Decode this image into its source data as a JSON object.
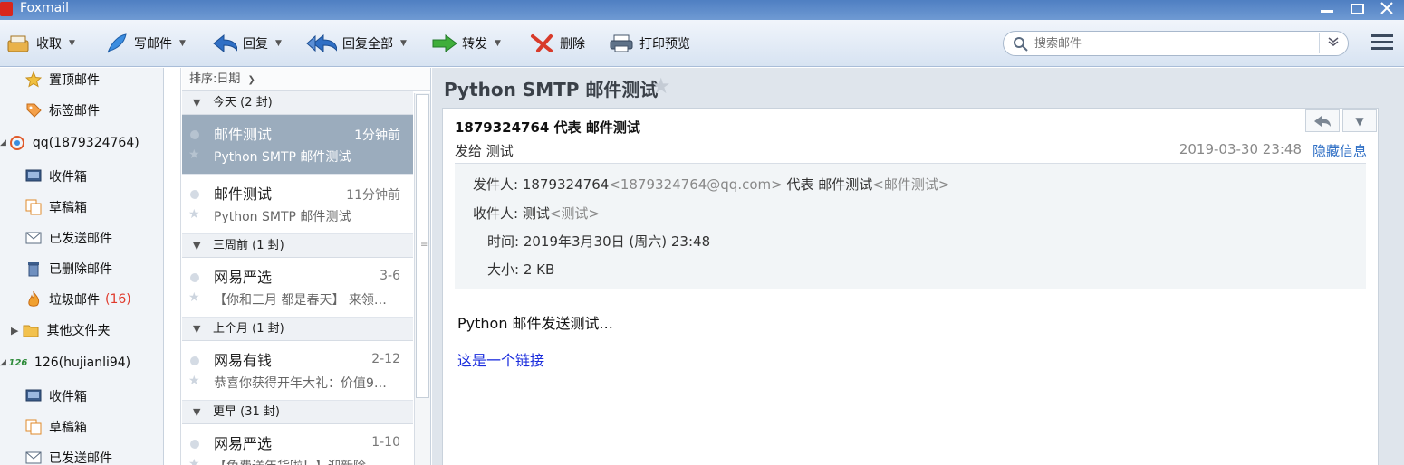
{
  "window": {
    "title": "Foxmail"
  },
  "toolbar": {
    "receive": "收取",
    "compose": "写邮件",
    "reply": "回复",
    "reply_all": "回复全部",
    "forward": "转发",
    "delete": "删除",
    "print_preview": "打印预览",
    "search_placeholder": "搜索邮件"
  },
  "sidebar": {
    "pinned": "置顶邮件",
    "tagged": "标签邮件",
    "account1": "qq(1879324764)",
    "a1_inbox": "收件箱",
    "a1_drafts": "草稿箱",
    "a1_sent": "已发送邮件",
    "a1_deleted": "已删除邮件",
    "a1_junk": "垃圾邮件",
    "a1_junk_count": "(16)",
    "a1_other": "其他文件夹",
    "account2": "126(hujianli94)",
    "a2_inbox": "收件箱",
    "a2_drafts": "草稿箱",
    "a2_sent": "已发送邮件"
  },
  "list": {
    "sort_label": "排序:日期",
    "groups": [
      "今天 (2 封)",
      "三周前 (1 封)",
      "上个月 (1 封)",
      "更早 (31 封)"
    ],
    "messages": [
      {
        "sender": "邮件测试",
        "time": "1分钟前",
        "subject": "Python SMTP 邮件测试"
      },
      {
        "sender": "邮件测试",
        "time": "11分钟前",
        "subject": "Python SMTP 邮件测试"
      },
      {
        "sender": "网易严选",
        "time": "3-6",
        "subject": "【你和三月 都是春天】 来领…"
      },
      {
        "sender": "网易有钱",
        "time": "2-12",
        "subject": "恭喜你获得开年大礼：价值9…"
      },
      {
        "sender": "网易严选",
        "time": "1-10",
        "subject": "【免费送年货啦！】迎新除…"
      }
    ]
  },
  "reader": {
    "title": "Python SMTP 邮件测试",
    "from_line": "1879324764 代表 邮件测试",
    "to_line": "发给 测试",
    "date": "2019-03-30 23:48",
    "hide_info": "隐藏信息",
    "details": {
      "sender_label": "发件人:",
      "sender_name": "1879324764",
      "sender_addr": "<1879324764@qq.com>",
      "sender_on_behalf": "代表 邮件测试",
      "sender_on_behalf_addr": "<邮件测试>",
      "recipient_label": "收件人:",
      "recipient_name": "测试",
      "recipient_addr": "<测试>",
      "time_label": "时间:",
      "time_value": "2019年3月30日 (周六) 23:48",
      "size_label": "大小:",
      "size_value": "2 KB"
    },
    "body_text": "Python 邮件发送测试...",
    "body_link": "这是一个链接"
  }
}
